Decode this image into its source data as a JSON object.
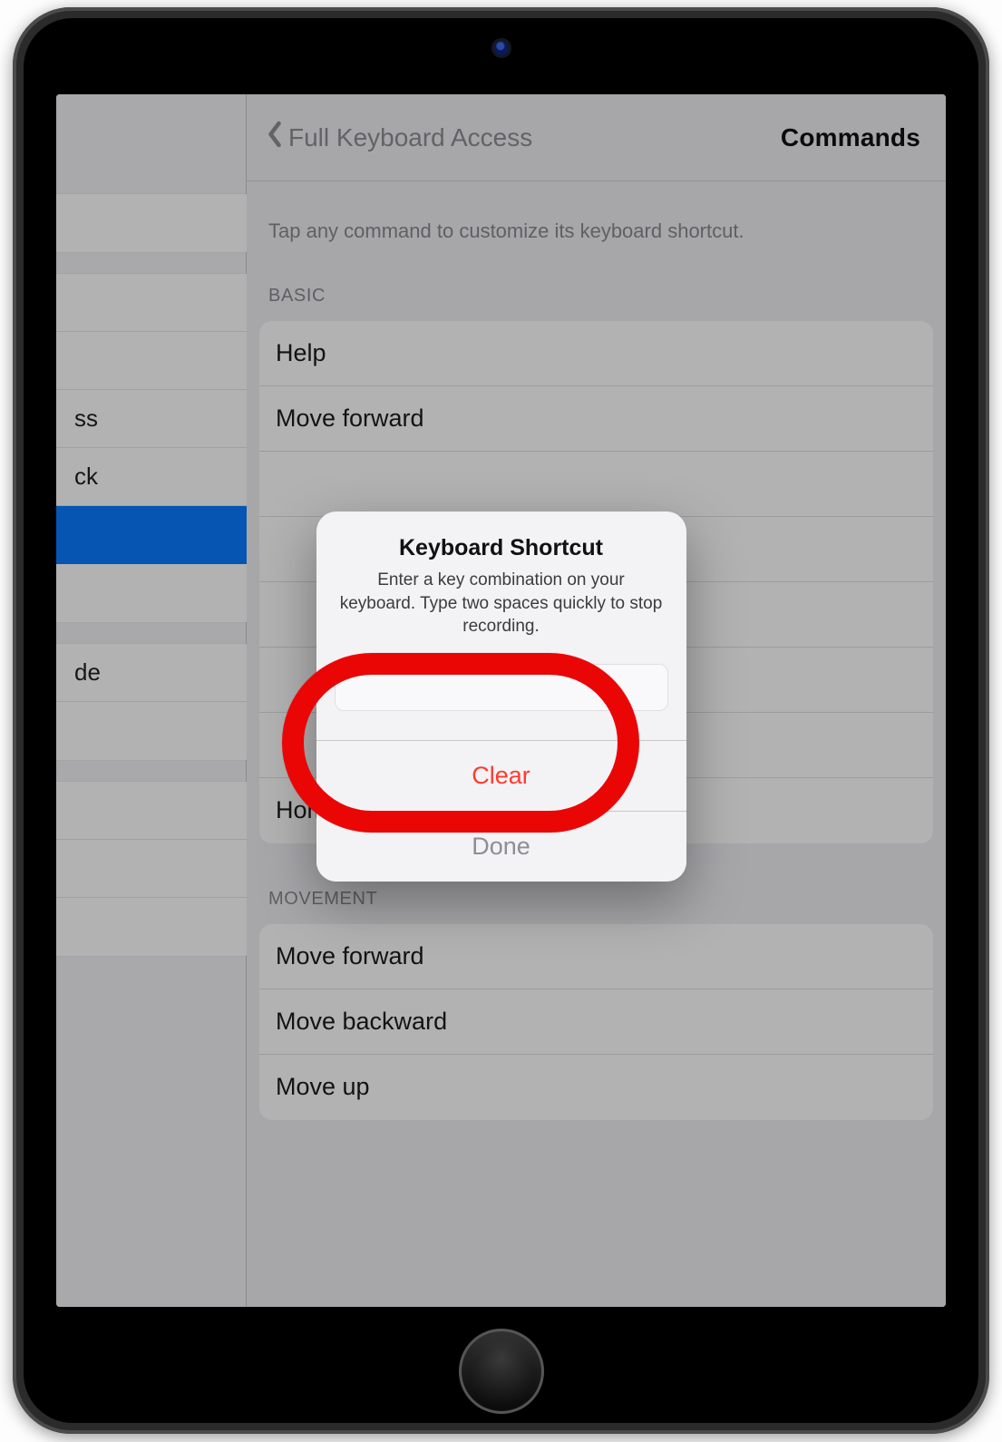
{
  "nav": {
    "back_label": "Full Keyboard Access",
    "title": "Commands"
  },
  "caption": "Tap any command to customize its keyboard shortcut.",
  "sidebar": {
    "groups": [
      {
        "items": [
          {
            "label": ""
          }
        ]
      },
      {
        "items": [
          {
            "label": ""
          },
          {
            "label": ""
          },
          {
            "label": "ss"
          },
          {
            "label": "ck"
          },
          {
            "label": "",
            "selected": true
          },
          {
            "label": ""
          }
        ]
      },
      {
        "items": [
          {
            "label": "de"
          },
          {
            "label": ""
          }
        ]
      },
      {
        "items": [
          {
            "label": ""
          },
          {
            "label": ""
          },
          {
            "label": ""
          }
        ]
      }
    ]
  },
  "sections": [
    {
      "header": "BASIC",
      "rows": [
        "Help",
        "Move forward",
        "",
        "",
        "",
        "",
        "",
        "Home"
      ]
    },
    {
      "header": "MOVEMENT",
      "rows": [
        "Move forward",
        "Move backward",
        "Move up"
      ]
    }
  ],
  "modal": {
    "title": "Keyboard Shortcut",
    "message": "Enter a key combination on your keyboard. Type two spaces quickly to stop recording.",
    "clear_label": "Clear",
    "done_label": "Done"
  }
}
